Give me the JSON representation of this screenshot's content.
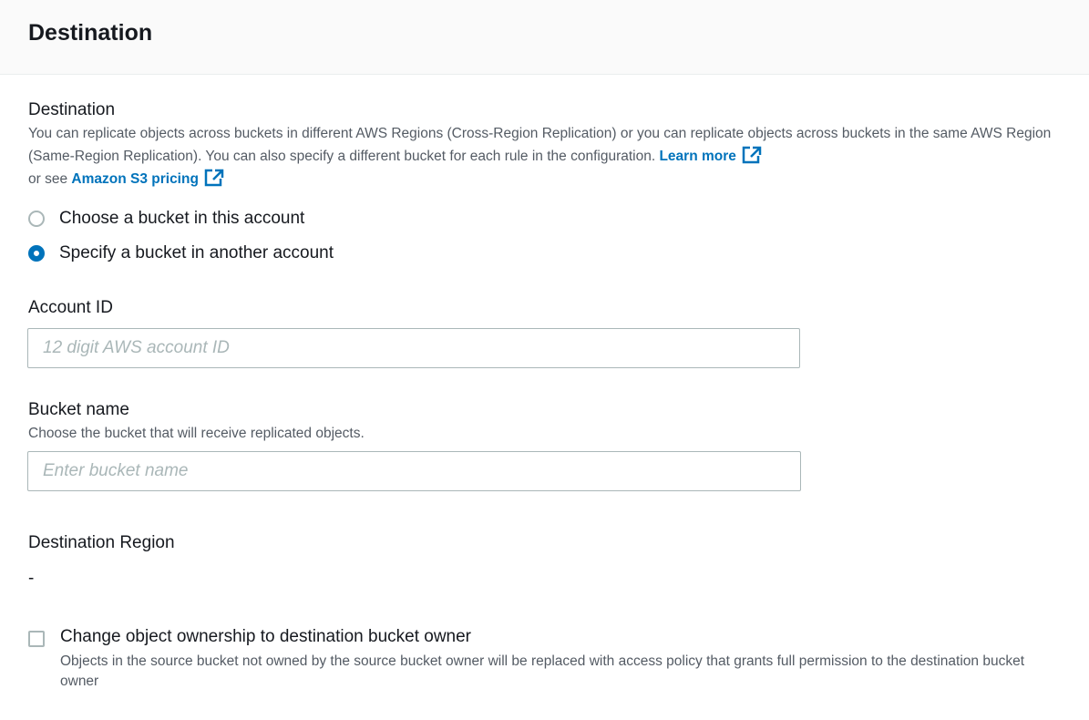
{
  "header": {
    "title": "Destination"
  },
  "destination": {
    "label": "Destination",
    "description": "You can replicate objects across buckets in different AWS Regions (Cross-Region Replication) or you can replicate objects across buckets in the same AWS Region (Same-Region Replication). You can also specify a different bucket for each rule in the configuration.",
    "learn_more": "Learn more",
    "or_see": "or see",
    "pricing_link": "Amazon S3 pricing",
    "options": [
      {
        "label": "Choose a bucket in this account",
        "selected": false
      },
      {
        "label": "Specify a bucket in another account",
        "selected": true
      }
    ]
  },
  "account_id": {
    "label": "Account ID",
    "placeholder": "12 digit AWS account ID",
    "value": ""
  },
  "bucket_name": {
    "label": "Bucket name",
    "description": "Choose the bucket that will receive replicated objects.",
    "placeholder": "Enter bucket name",
    "value": ""
  },
  "destination_region": {
    "label": "Destination Region",
    "value": "-"
  },
  "ownership": {
    "label": "Change object ownership to destination bucket owner",
    "description": "Objects in the source bucket not owned by the source bucket owner will be replaced with access policy that grants full permission to the destination bucket owner",
    "checked": false
  },
  "colors": {
    "link": "#0073bb",
    "text": "#16191f",
    "secondary_text": "#545b64",
    "border": "#aab7b8",
    "header_bg": "#fafafa"
  },
  "icons": {
    "external_link": "external-link-icon"
  }
}
